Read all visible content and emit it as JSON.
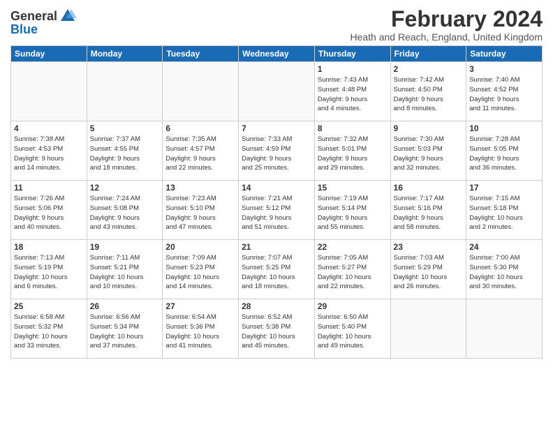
{
  "header": {
    "logo_general": "General",
    "logo_blue": "Blue",
    "month": "February 2024",
    "location": "Heath and Reach, England, United Kingdom"
  },
  "weekdays": [
    "Sunday",
    "Monday",
    "Tuesday",
    "Wednesday",
    "Thursday",
    "Friday",
    "Saturday"
  ],
  "weeks": [
    [
      {
        "day": "",
        "info": ""
      },
      {
        "day": "",
        "info": ""
      },
      {
        "day": "",
        "info": ""
      },
      {
        "day": "",
        "info": ""
      },
      {
        "day": "1",
        "info": "Sunrise: 7:43 AM\nSunset: 4:48 PM\nDaylight: 9 hours\nand 4 minutes."
      },
      {
        "day": "2",
        "info": "Sunrise: 7:42 AM\nSunset: 4:50 PM\nDaylight: 9 hours\nand 8 minutes."
      },
      {
        "day": "3",
        "info": "Sunrise: 7:40 AM\nSunset: 4:52 PM\nDaylight: 9 hours\nand 11 minutes."
      }
    ],
    [
      {
        "day": "4",
        "info": "Sunrise: 7:38 AM\nSunset: 4:53 PM\nDaylight: 9 hours\nand 14 minutes."
      },
      {
        "day": "5",
        "info": "Sunrise: 7:37 AM\nSunset: 4:55 PM\nDaylight: 9 hours\nand 18 minutes."
      },
      {
        "day": "6",
        "info": "Sunrise: 7:35 AM\nSunset: 4:57 PM\nDaylight: 9 hours\nand 22 minutes."
      },
      {
        "day": "7",
        "info": "Sunrise: 7:33 AM\nSunset: 4:59 PM\nDaylight: 9 hours\nand 25 minutes."
      },
      {
        "day": "8",
        "info": "Sunrise: 7:32 AM\nSunset: 5:01 PM\nDaylight: 9 hours\nand 29 minutes."
      },
      {
        "day": "9",
        "info": "Sunrise: 7:30 AM\nSunset: 5:03 PM\nDaylight: 9 hours\nand 32 minutes."
      },
      {
        "day": "10",
        "info": "Sunrise: 7:28 AM\nSunset: 5:05 PM\nDaylight: 9 hours\nand 36 minutes."
      }
    ],
    [
      {
        "day": "11",
        "info": "Sunrise: 7:26 AM\nSunset: 5:06 PM\nDaylight: 9 hours\nand 40 minutes."
      },
      {
        "day": "12",
        "info": "Sunrise: 7:24 AM\nSunset: 5:08 PM\nDaylight: 9 hours\nand 43 minutes."
      },
      {
        "day": "13",
        "info": "Sunrise: 7:23 AM\nSunset: 5:10 PM\nDaylight: 9 hours\nand 47 minutes."
      },
      {
        "day": "14",
        "info": "Sunrise: 7:21 AM\nSunset: 5:12 PM\nDaylight: 9 hours\nand 51 minutes."
      },
      {
        "day": "15",
        "info": "Sunrise: 7:19 AM\nSunset: 5:14 PM\nDaylight: 9 hours\nand 55 minutes."
      },
      {
        "day": "16",
        "info": "Sunrise: 7:17 AM\nSunset: 5:16 PM\nDaylight: 9 hours\nand 58 minutes."
      },
      {
        "day": "17",
        "info": "Sunrise: 7:15 AM\nSunset: 5:18 PM\nDaylight: 10 hours\nand 2 minutes."
      }
    ],
    [
      {
        "day": "18",
        "info": "Sunrise: 7:13 AM\nSunset: 5:19 PM\nDaylight: 10 hours\nand 6 minutes."
      },
      {
        "day": "19",
        "info": "Sunrise: 7:11 AM\nSunset: 5:21 PM\nDaylight: 10 hours\nand 10 minutes."
      },
      {
        "day": "20",
        "info": "Sunrise: 7:09 AM\nSunset: 5:23 PM\nDaylight: 10 hours\nand 14 minutes."
      },
      {
        "day": "21",
        "info": "Sunrise: 7:07 AM\nSunset: 5:25 PM\nDaylight: 10 hours\nand 18 minutes."
      },
      {
        "day": "22",
        "info": "Sunrise: 7:05 AM\nSunset: 5:27 PM\nDaylight: 10 hours\nand 22 minutes."
      },
      {
        "day": "23",
        "info": "Sunrise: 7:03 AM\nSunset: 5:29 PM\nDaylight: 10 hours\nand 26 minutes."
      },
      {
        "day": "24",
        "info": "Sunrise: 7:00 AM\nSunset: 5:30 PM\nDaylight: 10 hours\nand 30 minutes."
      }
    ],
    [
      {
        "day": "25",
        "info": "Sunrise: 6:58 AM\nSunset: 5:32 PM\nDaylight: 10 hours\nand 33 minutes."
      },
      {
        "day": "26",
        "info": "Sunrise: 6:56 AM\nSunset: 5:34 PM\nDaylight: 10 hours\nand 37 minutes."
      },
      {
        "day": "27",
        "info": "Sunrise: 6:54 AM\nSunset: 5:36 PM\nDaylight: 10 hours\nand 41 minutes."
      },
      {
        "day": "28",
        "info": "Sunrise: 6:52 AM\nSunset: 5:38 PM\nDaylight: 10 hours\nand 45 minutes."
      },
      {
        "day": "29",
        "info": "Sunrise: 6:50 AM\nSunset: 5:40 PM\nDaylight: 10 hours\nand 49 minutes."
      },
      {
        "day": "",
        "info": ""
      },
      {
        "day": "",
        "info": ""
      }
    ]
  ]
}
